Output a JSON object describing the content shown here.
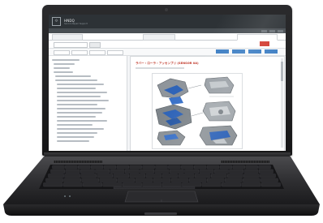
{
  "laptop": {
    "screen": {
      "app": {
        "logo_glyph": "⟐",
        "title": "HNDQ",
        "subtitle": "Service Repair Support"
      },
      "menu": [
        "",
        "",
        "",
        "",
        "",
        "",
        ""
      ],
      "tabs": [
        {
          "label": ""
        },
        {
          "label": ""
        },
        {
          "label": ""
        }
      ],
      "content": {
        "title": "ラバー・ローラ・アッセンブリ (SENSOR 0A)"
      },
      "colors": {
        "header": "#2d3236",
        "accent_red": "#c0392b",
        "accent_blue": "#3e7fc4",
        "diagram_part_blue": "#2f64b8"
      }
    },
    "icons": [
      "webcam-icon",
      "touchpad-icon"
    ]
  }
}
